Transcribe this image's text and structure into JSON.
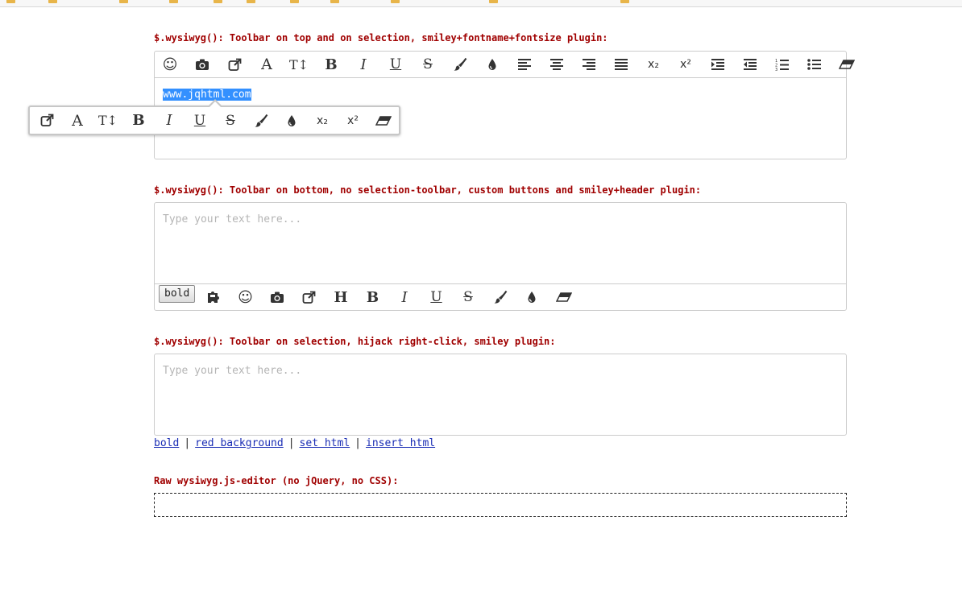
{
  "bookmarks_bar": {
    "items": [
      "",
      "",
      "",
      "",
      "",
      "",
      "",
      "",
      "",
      "",
      ""
    ]
  },
  "section1": {
    "title": "$.wysiwyg(): Toolbar on top and on selection, smiley+fontname+fontsize plugin:",
    "content": "www.jqhtml.com",
    "toolbar": [
      {
        "name": "smiley-icon",
        "label": "☺"
      },
      {
        "name": "camera-icon",
        "label": ""
      },
      {
        "name": "link-icon",
        "label": ""
      },
      {
        "name": "font-name-icon",
        "label": "A"
      },
      {
        "name": "font-size-icon",
        "label": "T↕"
      },
      {
        "name": "bold-icon",
        "label": "B"
      },
      {
        "name": "italic-icon",
        "label": "I"
      },
      {
        "name": "underline-icon",
        "label": "U"
      },
      {
        "name": "strikethrough-icon",
        "label": "S"
      },
      {
        "name": "brush-icon",
        "label": ""
      },
      {
        "name": "drop-icon",
        "label": ""
      },
      {
        "name": "align-left-icon",
        "label": ""
      },
      {
        "name": "align-center-icon",
        "label": ""
      },
      {
        "name": "align-right-icon",
        "label": ""
      },
      {
        "name": "align-justify-icon",
        "label": ""
      },
      {
        "name": "subscript-icon",
        "label": "x₂"
      },
      {
        "name": "superscript-icon",
        "label": "x²"
      },
      {
        "name": "indent-icon",
        "label": ""
      },
      {
        "name": "outdent-icon",
        "label": ""
      },
      {
        "name": "ordered-list-icon",
        "label": ""
      },
      {
        "name": "unordered-list-icon",
        "label": ""
      },
      {
        "name": "eraser-icon",
        "label": ""
      }
    ],
    "selection_toolbar": [
      {
        "name": "link-icon",
        "label": ""
      },
      {
        "name": "font-name-icon",
        "label": "A"
      },
      {
        "name": "font-size-icon",
        "label": "T↕"
      },
      {
        "name": "bold-icon",
        "label": "B"
      },
      {
        "name": "italic-icon",
        "label": "I"
      },
      {
        "name": "underline-icon",
        "label": "U"
      },
      {
        "name": "strikethrough-icon",
        "label": "S"
      },
      {
        "name": "brush-icon",
        "label": ""
      },
      {
        "name": "drop-icon",
        "label": ""
      },
      {
        "name": "subscript-icon",
        "label": "x₂"
      },
      {
        "name": "superscript-icon",
        "label": "x²"
      },
      {
        "name": "eraser-icon",
        "label": ""
      }
    ]
  },
  "section2": {
    "title": "$.wysiwyg(): Toolbar on bottom, no selection-toolbar, custom buttons and smiley+header plugin:",
    "placeholder": "Type your text here...",
    "bold_button": "bold",
    "toolbar": [
      {
        "name": "puzzle-icon",
        "label": ""
      },
      {
        "name": "smiley-icon",
        "label": "☺"
      },
      {
        "name": "camera-icon",
        "label": ""
      },
      {
        "name": "link-icon",
        "label": ""
      },
      {
        "name": "header-icon",
        "label": "H"
      },
      {
        "name": "bold-icon",
        "label": "B"
      },
      {
        "name": "italic-icon",
        "label": "I"
      },
      {
        "name": "underline-icon",
        "label": "U"
      },
      {
        "name": "strikethrough-icon",
        "label": "S"
      },
      {
        "name": "brush-icon",
        "label": ""
      },
      {
        "name": "drop-icon",
        "label": ""
      },
      {
        "name": "eraser-icon",
        "label": ""
      }
    ]
  },
  "section3": {
    "title": "$.wysiwyg(): Toolbar on selection, hijack right-click, smiley plugin:",
    "placeholder": "Type your text here...",
    "links": [
      "bold",
      "red background",
      "set html",
      "insert html"
    ]
  },
  "section4": {
    "title": "Raw wysiwyg.js-editor (no jQuery, no CSS):"
  },
  "colors": {
    "title": "#a00000",
    "link": "#1a2db5",
    "selection": "#3390ff",
    "border": "#cccccc"
  }
}
